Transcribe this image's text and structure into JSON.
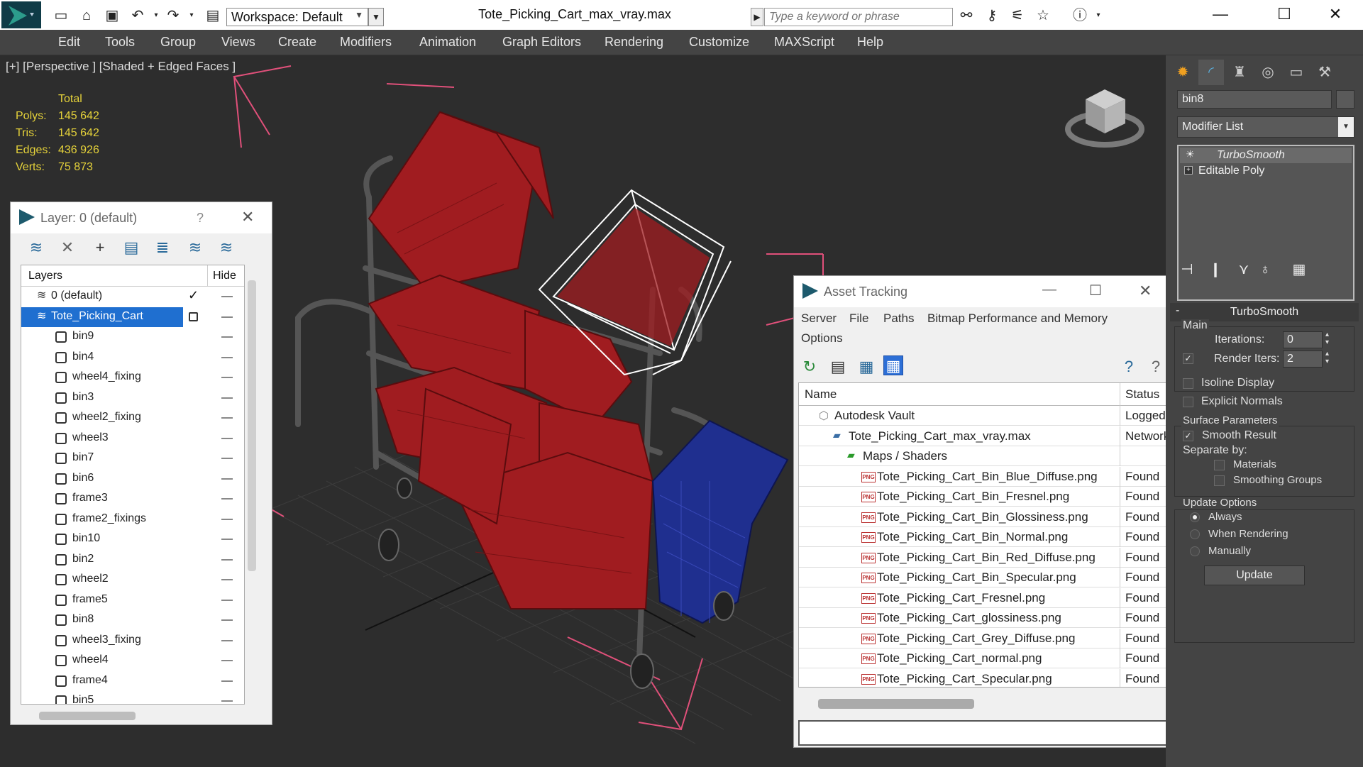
{
  "titlebar": {
    "workspace": "Workspace: Default",
    "doc_title": "Tote_Picking_Cart_max_vray.max",
    "search_placeholder": "Type a keyword or phrase"
  },
  "menu": [
    "Edit",
    "Tools",
    "Group",
    "Views",
    "Create",
    "Modifiers",
    "Animation",
    "Graph Editors",
    "Rendering",
    "Customize",
    "MAXScript",
    "Help"
  ],
  "viewport": {
    "label": "[+] [Perspective ] [Shaded + Edged Faces ]",
    "stats_header": "Total",
    "stats": [
      {
        "label": "Polys:",
        "value": "145 642"
      },
      {
        "label": "Tris:",
        "value": "145 642"
      },
      {
        "label": "Edges:",
        "value": "436 926"
      },
      {
        "label": "Verts:",
        "value": "75 873"
      }
    ]
  },
  "layer_panel": {
    "title": "Layer: 0 (default)",
    "help": "?",
    "col_layers": "Layers",
    "col_hide": "Hide",
    "rows": [
      {
        "name": "0 (default)"
      },
      {
        "name": "Tote_Picking_Cart"
      },
      {
        "name": "bin9"
      },
      {
        "name": "bin4"
      },
      {
        "name": "wheel4_fixing"
      },
      {
        "name": "bin3"
      },
      {
        "name": "wheel2_fixing"
      },
      {
        "name": "wheel3"
      },
      {
        "name": "bin7"
      },
      {
        "name": "bin6"
      },
      {
        "name": "frame3"
      },
      {
        "name": "frame2_fixings"
      },
      {
        "name": "bin10"
      },
      {
        "name": "bin2"
      },
      {
        "name": "wheel2"
      },
      {
        "name": "frame5"
      },
      {
        "name": "bin8"
      },
      {
        "name": "wheel3_fixing"
      },
      {
        "name": "wheel4"
      },
      {
        "name": "frame4"
      },
      {
        "name": "bin5"
      }
    ]
  },
  "asset_panel": {
    "title": "Asset Tracking",
    "menus": [
      "Server",
      "File",
      "Paths",
      "Bitmap Performance and Memory",
      "Options"
    ],
    "col_name": "Name",
    "col_status": "Status",
    "rows": [
      {
        "name": "Autodesk Vault",
        "status": "Logged"
      },
      {
        "name": "Tote_Picking_Cart_max_vray.max",
        "status": "Network"
      },
      {
        "name": "Maps / Shaders",
        "status": ""
      },
      {
        "name": "Tote_Picking_Cart_Bin_Blue_Diffuse.png",
        "status": "Found"
      },
      {
        "name": "Tote_Picking_Cart_Bin_Fresnel.png",
        "status": "Found"
      },
      {
        "name": "Tote_Picking_Cart_Bin_Glossiness.png",
        "status": "Found"
      },
      {
        "name": "Tote_Picking_Cart_Bin_Normal.png",
        "status": "Found"
      },
      {
        "name": "Tote_Picking_Cart_Bin_Red_Diffuse.png",
        "status": "Found"
      },
      {
        "name": "Tote_Picking_Cart_Bin_Specular.png",
        "status": "Found"
      },
      {
        "name": "Tote_Picking_Cart_Fresnel.png",
        "status": "Found"
      },
      {
        "name": "Tote_Picking_Cart_glossiness.png",
        "status": "Found"
      },
      {
        "name": "Tote_Picking_Cart_Grey_Diffuse.png",
        "status": "Found"
      },
      {
        "name": "Tote_Picking_Cart_normal.png",
        "status": "Found"
      },
      {
        "name": "Tote_Picking_Cart_Specular.png",
        "status": "Found"
      }
    ],
    "png_badge": "PNG"
  },
  "command_panel": {
    "object_name": "bin8",
    "modifier_list": "Modifier List",
    "stack": [
      "TurboSmooth",
      "Editable Poly"
    ],
    "rollout_title": "TurboSmooth",
    "main_group": "Main",
    "iterations_label": "Iterations:",
    "iterations_value": "0",
    "render_iters_label": "Render Iters:",
    "render_iters_value": "2",
    "isoline_display": "Isoline Display",
    "explicit_normals": "Explicit Normals",
    "surface_params": "Surface Parameters",
    "smooth_result": "Smooth Result",
    "separate_by": "Separate by:",
    "materials": "Materials",
    "smoothing_groups": "Smoothing Groups",
    "update_options": "Update Options",
    "always": "Always",
    "when_rendering": "When Rendering",
    "manually": "Manually",
    "update_button": "Update"
  },
  "colors": {
    "bin_red": "#a01c20",
    "bin_blue": "#1f2f8f",
    "selection_white": "#ffffff",
    "stats_yellow": "#e5d23a",
    "bbox_pink": "#e0507a",
    "selected_row": "#1f6fd0"
  }
}
